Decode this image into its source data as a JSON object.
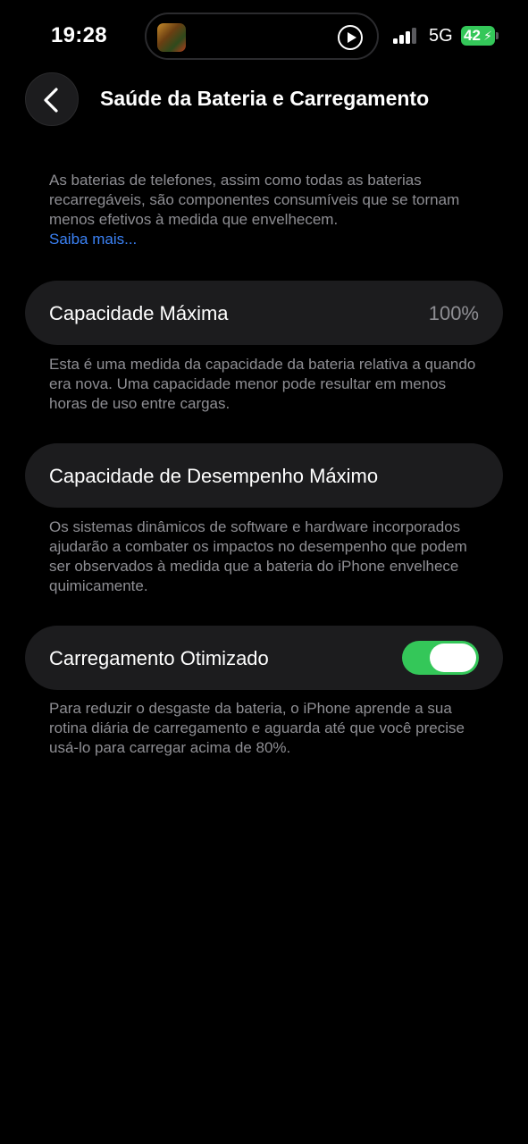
{
  "status_bar": {
    "time": "19:28",
    "network": "5G",
    "battery_level": "42"
  },
  "nav": {
    "title": "Saúde da Bateria e Carregamento"
  },
  "intro": {
    "text": "As baterias de telefones, assim como todas as baterias recarregáveis, são componentes consumíveis que se tornam menos efetivos à medida que envelhecem.",
    "link": "Saiba mais..."
  },
  "max_capacity": {
    "label": "Capacidade Máxima",
    "value": "100%",
    "description": "Esta é uma medida da capacidade da bateria relativa a quando era nova. Uma capacidade menor pode resultar em menos horas de uso entre cargas."
  },
  "peak_performance": {
    "label": "Capacidade de Desempenho Máximo",
    "description": "Os sistemas dinâmicos de software e hardware incorporados ajudarão a combater os impactos no desempenho que podem ser observados à medida que a bateria do iPhone envelhece quimicamente."
  },
  "optimized_charging": {
    "label": "Carregamento Otimizado",
    "enabled": true,
    "description": "Para reduzir o desgaste da bateria, o iPhone aprende a sua rotina diária de carregamento e aguarda até que você precise usá-lo para carregar acima de 80%."
  },
  "colors": {
    "accent_green": "#34c759",
    "link_blue": "#3b82f6",
    "cell_bg": "#1c1c1e",
    "secondary_text": "#8e8e93"
  }
}
